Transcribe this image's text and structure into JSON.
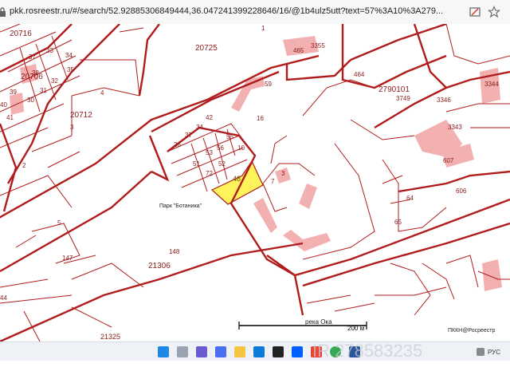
{
  "browser": {
    "url": "pkk.rosreestr.ru/#/search/52.92885306849444,36.047241399228646/16/@1b4ulz5utt?text=57%3A10%3A279..."
  },
  "map": {
    "parcel_labels": [
      "20716",
      "20725",
      "20706",
      "20712",
      "465",
      "3355",
      "464",
      "2790101",
      "3749",
      "3344",
      "3346",
      "3343",
      "607",
      "606",
      "64",
      "65",
      "59",
      "16",
      "42",
      "55",
      "36",
      "37",
      "34",
      "51",
      "53",
      "56",
      "52",
      "10",
      "72",
      "48",
      "7",
      "3",
      "5",
      "147",
      "148",
      "21306",
      "44",
      "21325",
      "1",
      "4",
      "3",
      "2",
      "37",
      "38",
      "39",
      "40",
      "41",
      "30",
      "31",
      "32",
      "33",
      "34",
      "35"
    ],
    "highlighted_parcel": "48",
    "park_label": "Парк \"Ботаника\"",
    "river_label": "река Ока",
    "scale_label": "200 м",
    "attribution": "ПККН@Росреестр",
    "highlight_color": "#fff35c",
    "line_color": "#b01c1c",
    "building_color": "#f0a0a0"
  },
  "taskbar": {
    "apps": [
      "windows-start",
      "search",
      "task-view",
      "files",
      "edge",
      "mail",
      "amazon",
      "dropbox",
      "chrome",
      "word",
      "store"
    ],
    "tray_text": "РУС",
    "watermark": "IR 278583235"
  }
}
